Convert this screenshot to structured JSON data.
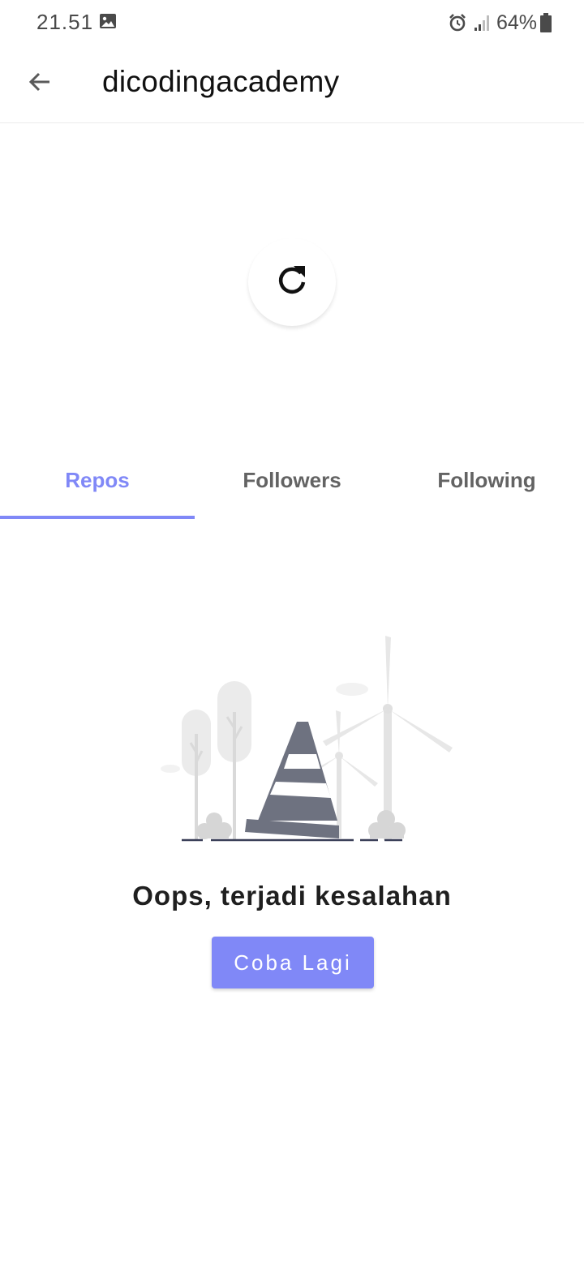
{
  "status_bar": {
    "time": "21.51",
    "battery": "64%",
    "icons": [
      "gallery-icon",
      "alarm-icon",
      "signal-icon",
      "battery-icon"
    ]
  },
  "app_bar": {
    "title": "dicodingacademy",
    "back_icon": "arrow-left-icon"
  },
  "profile": {
    "refresh_icon": "refresh-icon"
  },
  "tabs": [
    {
      "label": "Repos",
      "active": true
    },
    {
      "label": "Followers",
      "active": false
    },
    {
      "label": "Following",
      "active": false
    }
  ],
  "error": {
    "illustration": "traffic-cone-wind-turbines-illustration",
    "message": "Oops, terjadi kesalahan",
    "retry_label": "Coba Lagi"
  },
  "colors": {
    "accent": "#8088f7",
    "tab_inactive": "#636363",
    "text_primary": "#111111",
    "cone": "#6e7280"
  }
}
